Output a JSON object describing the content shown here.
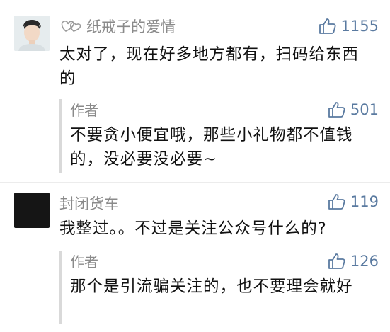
{
  "comments": [
    {
      "username": "纸戒子的爱情",
      "likes": "1155",
      "text": "太对了，现在好多地方都有，扫码给东西的",
      "reply": {
        "author": "作者",
        "likes": "501",
        "text": "不要贪小便宜哦，那些小礼物都不值钱的，没必要没必要~"
      }
    },
    {
      "username": "封闭货车",
      "likes": "119",
      "text": "我整过。。不过是关注公众号什么的?",
      "reply": {
        "author": "作者",
        "likes": "126",
        "text": "那个是引流骗关注的，也不要理会就好"
      }
    }
  ],
  "colors": {
    "like": "#5a7aa0",
    "text": "#111111",
    "meta": "#8a8a8a",
    "reply_border": "#d9d9d9"
  },
  "icons": {
    "like": "thumbs-up-icon",
    "username_decoration": "heart-doodle-icon"
  }
}
